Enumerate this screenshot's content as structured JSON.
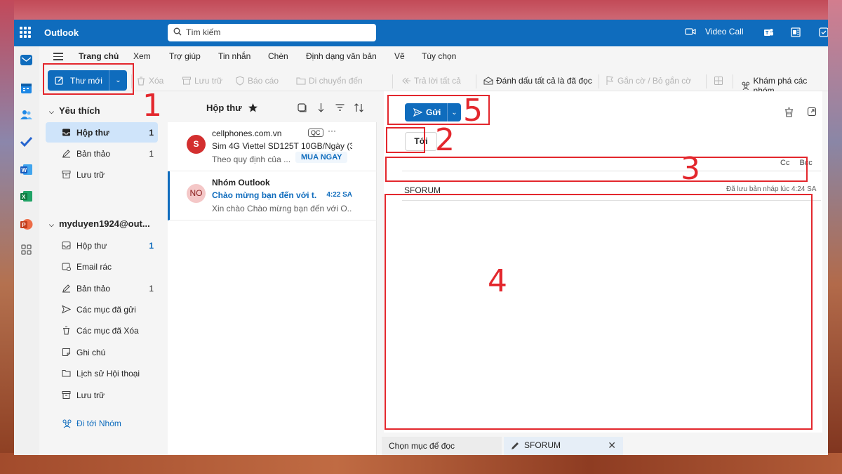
{
  "topbar": {
    "app_name": "Outlook",
    "search_placeholder": "Tìm kiếm",
    "video_call_label": "Video Call",
    "brand_color": "#0f6cbd"
  },
  "ribbon": {
    "tabs": [
      "Trang chủ",
      "Xem",
      "Trợ giúp",
      "Tin nhắn",
      "Chèn",
      "Định dạng văn bản",
      "Vẽ",
      "Tùy chọn"
    ],
    "active_tab": "Trang chủ",
    "new_mail_label": "Thư mới",
    "actions": {
      "delete": "Xóa",
      "archive": "Lưu trữ",
      "report": "Báo cáo",
      "move": "Di chuyển đến",
      "reply_all": "Trả lời tất cả",
      "mark_all_read": "Đánh dấu tất cả là đã đọc",
      "flag": "Gắn cờ / Bỏ gắn cờ",
      "explore_groups": "Khám phá các nhóm"
    }
  },
  "folders": {
    "favorites_label": "Yêu thích",
    "favorites": [
      {
        "label": "Hộp thư",
        "count": "1"
      },
      {
        "label": "Bản thảo",
        "count": "1"
      },
      {
        "label": "Lưu trữ",
        "count": ""
      }
    ],
    "account_label": "myduyen1924@out...",
    "account_folders": [
      {
        "label": "Hộp thư",
        "count": "1"
      },
      {
        "label": "Email rác",
        "count": ""
      },
      {
        "label": "Bản thảo",
        "count": "1"
      },
      {
        "label": "Các mục đã gửi",
        "count": ""
      },
      {
        "label": "Các mục đã Xóa",
        "count": ""
      },
      {
        "label": "Ghi chú",
        "count": ""
      },
      {
        "label": "Lịch sử Hội thoại",
        "count": ""
      },
      {
        "label": "Lưu trữ",
        "count": ""
      }
    ],
    "go_to_groups": "Đi tới Nhóm"
  },
  "maillist": {
    "title": "Hộp thư",
    "messages": [
      {
        "avatar": "S",
        "from": "cellphones.com.vn",
        "ad_badge": "QC",
        "subject": "Sim 4G Viettel SD125T 10GB/Ngày (30",
        "preview": "Theo quy định của ...",
        "cta": "MUA NGAY"
      },
      {
        "avatar": "NO",
        "from": "Nhóm Outlook",
        "subject": "Chào mừng bạn đến với t...",
        "time": "4:22 SA",
        "preview": "Xin chào Chào mừng bạn đến với O..."
      }
    ]
  },
  "compose": {
    "send_label": "Gửi",
    "to_label": "Tới",
    "cc_label": "Cc",
    "bcc_label": "Bcc",
    "subject_value": "SFORUM",
    "saved_status": "Đã lưu bản nháp lúc 4:24 SA"
  },
  "bottom_tabs": {
    "select_item": "Chọn mục để đọc",
    "draft_tab": "SFORUM"
  },
  "annotations": [
    "1",
    "2",
    "3",
    "4",
    "5"
  ],
  "annotation_color": "#e3272d"
}
